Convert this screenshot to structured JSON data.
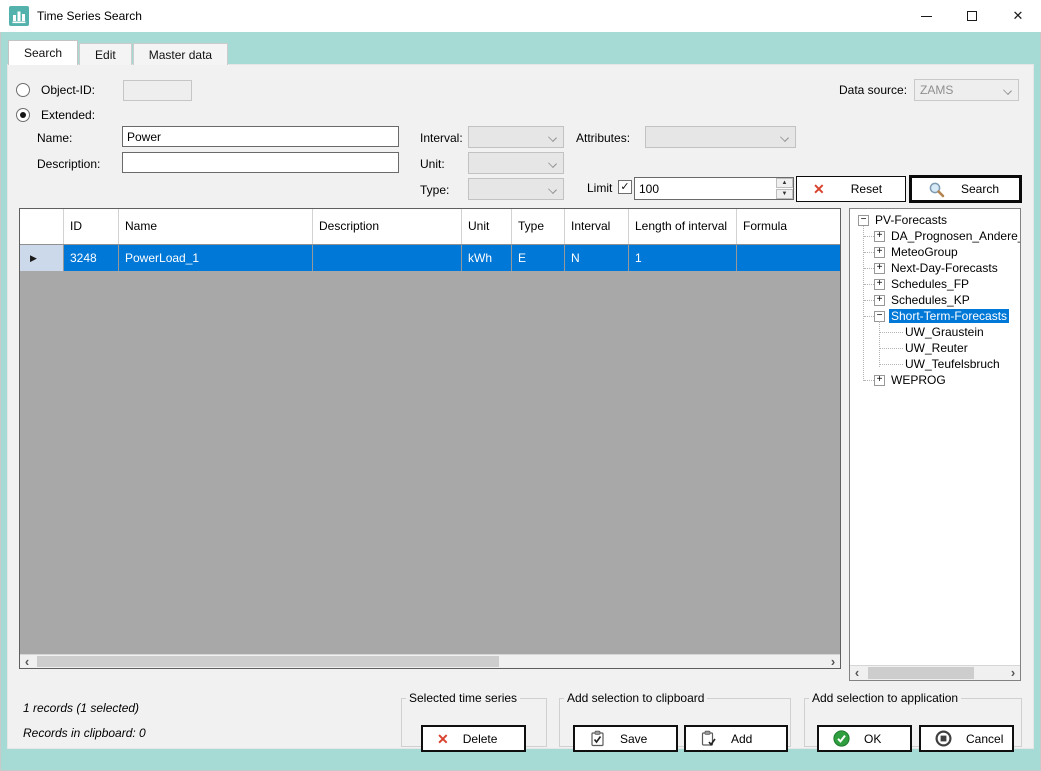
{
  "window": {
    "title": "Time Series Search"
  },
  "tabs": {
    "search": "Search",
    "edit": "Edit",
    "master_data": "Master data"
  },
  "form": {
    "object_id_label": "Object-ID:",
    "object_id_value": "",
    "extended_label": "Extended:",
    "name_label": "Name:",
    "name_value": "Power",
    "description_label": "Description:",
    "description_value": "",
    "interval_label": "Interval:",
    "unit_label": "Unit:",
    "type_label": "Type:",
    "attributes_label": "Attributes:",
    "limit_label": "Limit",
    "limit_checked": true,
    "limit_value": "100",
    "data_source_label": "Data source:",
    "data_source_value": "ZAMS",
    "reset_label": "Reset",
    "search_label": "Search"
  },
  "table": {
    "columns": {
      "id": "ID",
      "name": "Name",
      "description": "Description",
      "unit": "Unit",
      "type": "Type",
      "interval": "Interval",
      "length_of_interval": "Length of interval",
      "formula": "Formula"
    },
    "rows": [
      {
        "id": "3248",
        "name": "PowerLoad_1",
        "description": "",
        "unit": "kWh",
        "type": "E",
        "interval": "N",
        "length_of_interval": "1",
        "formula": "",
        "selected": true
      }
    ]
  },
  "tree": {
    "items": [
      {
        "label": "PV-Forecasts",
        "level": 0,
        "expander": "minus",
        "selected": false
      },
      {
        "label": "DA_Prognosen_Andere_",
        "level": 1,
        "expander": "plus",
        "selected": false
      },
      {
        "label": "MeteoGroup",
        "level": 1,
        "expander": "plus",
        "selected": false
      },
      {
        "label": "Next-Day-Forecasts",
        "level": 1,
        "expander": "plus",
        "selected": false
      },
      {
        "label": "Schedules_FP",
        "level": 1,
        "expander": "plus",
        "selected": false
      },
      {
        "label": "Schedules_KP",
        "level": 1,
        "expander": "plus",
        "selected": false
      },
      {
        "label": "Short-Term-Forecasts",
        "level": 1,
        "expander": "minus",
        "selected": true
      },
      {
        "label": "UW_Graustein",
        "level": 2,
        "expander": "none",
        "selected": false
      },
      {
        "label": "UW_Reuter",
        "level": 2,
        "expander": "none",
        "selected": false
      },
      {
        "label": "UW_Teufelsbruch",
        "level": 2,
        "expander": "none",
        "selected": false
      },
      {
        "label": "WEPROG",
        "level": 1,
        "expander": "plus",
        "selected": false
      }
    ]
  },
  "status": {
    "records": "1 records (1 selected)",
    "clipboard": "Records in clipboard: 0"
  },
  "groups": {
    "selected": {
      "title": "Selected time series",
      "delete_label": "Delete"
    },
    "clipboard": {
      "title": "Add selection to clipboard",
      "save_label": "Save",
      "add_label": "Add"
    },
    "application": {
      "title": "Add selection to application",
      "ok_label": "OK",
      "cancel_label": "Cancel"
    }
  },
  "icons": {
    "close": "✕",
    "x_red": "✕",
    "check": "✓",
    "row_arrow": "▶",
    "plus": "+",
    "minus": "−",
    "scroll_left": "‹",
    "scroll_right": "›",
    "spin_up": "▲",
    "spin_down": "▼"
  },
  "colors": {
    "accent_teal": "#a6dad5",
    "icon_teal": "#53b2ab",
    "selection_blue": "#0078d7"
  }
}
